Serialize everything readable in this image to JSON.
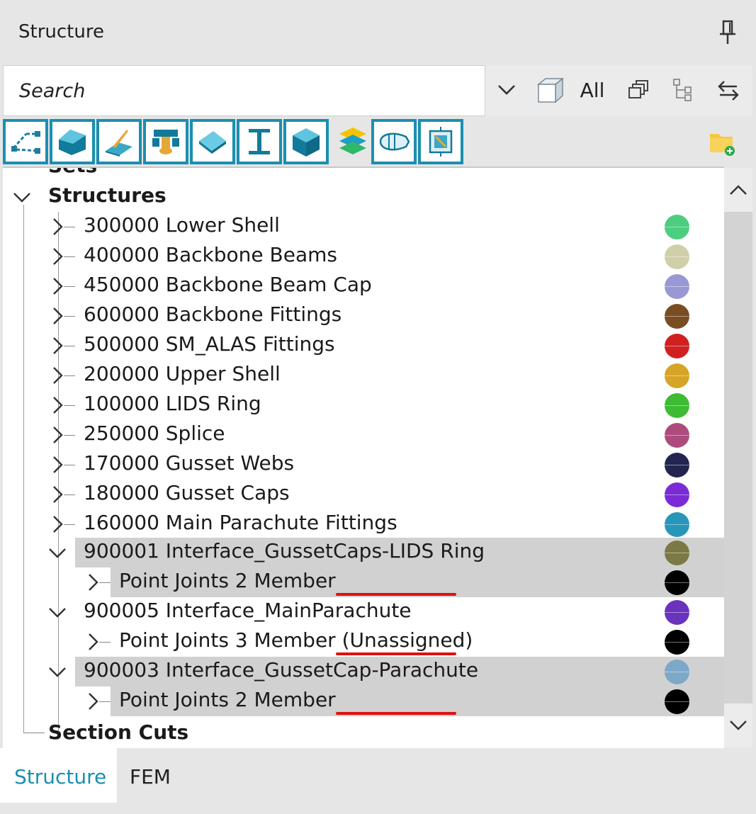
{
  "panel": {
    "title": "Structure"
  },
  "search": {
    "placeholder": "Search",
    "filter_label": "All"
  },
  "tree": {
    "partial_top": "Sets",
    "root": "Structures",
    "items": [
      {
        "label": "300000 Lower Shell",
        "color": "#4ccd80"
      },
      {
        "label": "400000 Backbone Beams",
        "color": "#cfcfa9"
      },
      {
        "label": "450000 Backbone Beam Cap",
        "color": "#9a98d4"
      },
      {
        "label": "600000 Backbone Fittings",
        "color": "#7a4c22"
      },
      {
        "label": "500000 SM_ALAS Fittings",
        "color": "#d02020"
      },
      {
        "label": "200000 Upper Shell",
        "color": "#d6a426"
      },
      {
        "label": "100000 LIDS Ring",
        "color": "#3dbb33"
      },
      {
        "label": "250000 Splice",
        "color": "#ad4c7c"
      },
      {
        "label": "170000 Gusset Webs",
        "color": "#232550"
      },
      {
        "label": "180000 Gusset Caps",
        "color": "#7a2bd6"
      },
      {
        "label": "160000 Main Parachute Fittings",
        "color": "#2896b8"
      }
    ],
    "groups": [
      {
        "label": "900001 Interface_GussetCaps-LIDS Ring",
        "color": "#7b7944",
        "child": {
          "label": "Point Joints 2 Member",
          "color": "#000000"
        }
      },
      {
        "label": "900005 Interface_MainParachute",
        "color": "#6a33bb",
        "child": {
          "label": "Point Joints 3 Member (Unassigned)",
          "color": "#000000"
        }
      },
      {
        "label": "900003 Interface_GussetCap-Parachute",
        "color": "#7ea8c8",
        "child": {
          "label": "Point Joints 2 Member",
          "color": "#000000"
        }
      }
    ],
    "section_cuts": "Section Cuts"
  },
  "tabs": {
    "structure": "Structure",
    "fem": "FEM"
  }
}
